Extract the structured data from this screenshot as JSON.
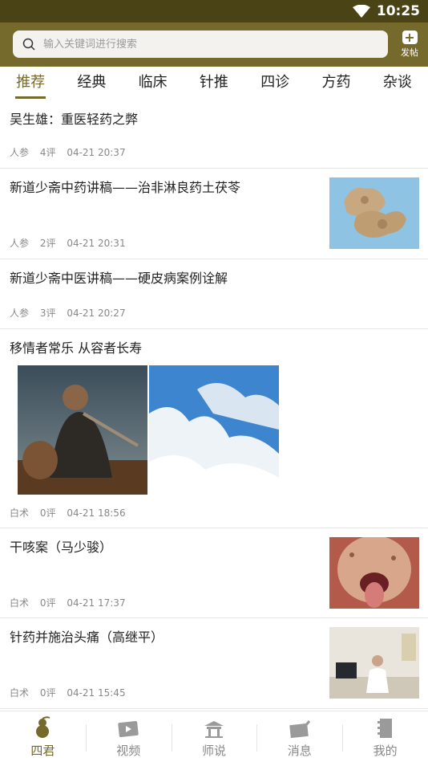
{
  "status": {
    "time": "10:25"
  },
  "search": {
    "placeholder": "输入关键词进行搜索"
  },
  "post_button": {
    "label": "发帖"
  },
  "tabs": [
    "推荐",
    "经典",
    "临床",
    "针推",
    "四诊",
    "方药",
    "杂谈"
  ],
  "active_tab": "推荐",
  "feed": [
    {
      "title": "吴生雄：重医轻药之弊",
      "author": "人参",
      "comments": "4评",
      "time": "04-21 20:37"
    },
    {
      "title": "新道少斋中药讲稿——治非淋良药土茯苓",
      "author": "人参",
      "comments": "2评",
      "time": "04-21 20:31"
    },
    {
      "title": "新道少斋中医讲稿——硬皮病案例诠解",
      "author": "人参",
      "comments": "3评",
      "time": "04-21 20:27"
    },
    {
      "title": "移情者常乐 从容者长寿",
      "author": "白术",
      "comments": "0评",
      "time": "04-21 18:56"
    },
    {
      "title": "干咳案（马少骏）",
      "author": "白术",
      "comments": "0评",
      "time": "04-21 17:37"
    },
    {
      "title": "针药并施治头痛（高继平）",
      "author": "白术",
      "comments": "0评",
      "time": "04-21 15:45"
    }
  ],
  "bottom_nav": [
    {
      "label": "四君",
      "icon": "gourd-icon"
    },
    {
      "label": "视频",
      "icon": "video-icon"
    },
    {
      "label": "师说",
      "icon": "pavilion-icon"
    },
    {
      "label": "消息",
      "icon": "message-icon"
    },
    {
      "label": "我的",
      "icon": "book-icon"
    }
  ],
  "colors": {
    "brand": "#75692c",
    "status_bar": "#4a4316"
  }
}
